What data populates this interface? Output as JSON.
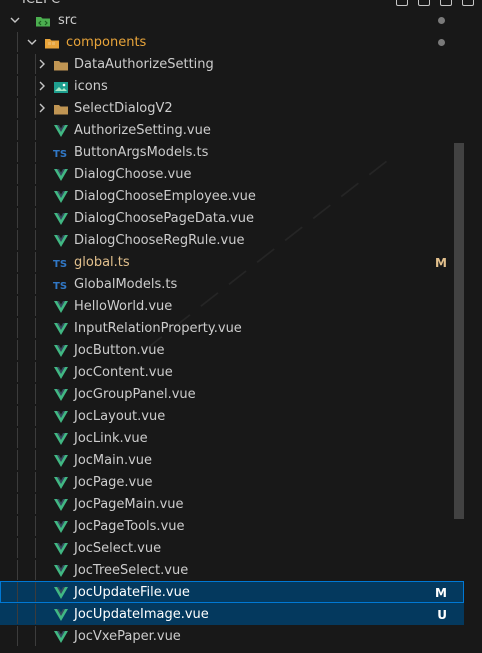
{
  "topbar": {
    "title": "ICEPC"
  },
  "tree": {
    "src": {
      "label": "src"
    },
    "components": {
      "label": "components"
    },
    "folders": [
      {
        "label": "DataAuthorizeSetting",
        "icon": "folder-icon"
      },
      {
        "label": "icons",
        "icon": "image-folder-icon"
      },
      {
        "label": "SelectDialogV2",
        "icon": "folder-icon"
      }
    ],
    "files": [
      {
        "label": "AuthorizeSetting.vue",
        "type": "vue",
        "badge": ""
      },
      {
        "label": "ButtonArgsModels.ts",
        "type": "ts",
        "badge": ""
      },
      {
        "label": "DialogChoose.vue",
        "type": "vue",
        "badge": ""
      },
      {
        "label": "DialogChooseEmployee.vue",
        "type": "vue",
        "badge": ""
      },
      {
        "label": "DialogChoosePageData.vue",
        "type": "vue",
        "badge": ""
      },
      {
        "label": "DialogChooseRegRule.vue",
        "type": "vue",
        "badge": ""
      },
      {
        "label": "global.ts",
        "type": "ts",
        "badge": "M"
      },
      {
        "label": "GlobalModels.ts",
        "type": "ts",
        "badge": ""
      },
      {
        "label": "HelloWorld.vue",
        "type": "vue",
        "badge": ""
      },
      {
        "label": "InputRelationProperty.vue",
        "type": "vue",
        "badge": ""
      },
      {
        "label": "JocButton.vue",
        "type": "vue",
        "badge": ""
      },
      {
        "label": "JocContent.vue",
        "type": "vue",
        "badge": ""
      },
      {
        "label": "JocGroupPanel.vue",
        "type": "vue",
        "badge": ""
      },
      {
        "label": "JocLayout.vue",
        "type": "vue",
        "badge": ""
      },
      {
        "label": "JocLink.vue",
        "type": "vue",
        "badge": ""
      },
      {
        "label": "JocMain.vue",
        "type": "vue",
        "badge": ""
      },
      {
        "label": "JocPage.vue",
        "type": "vue",
        "badge": ""
      },
      {
        "label": "JocPageMain.vue",
        "type": "vue",
        "badge": ""
      },
      {
        "label": "JocPageTools.vue",
        "type": "vue",
        "badge": ""
      },
      {
        "label": "JocSelect.vue",
        "type": "vue",
        "badge": ""
      },
      {
        "label": "JocTreeSelect.vue",
        "type": "vue",
        "badge": ""
      },
      {
        "label": "JocUpdateFile.vue",
        "type": "vue",
        "badge": "M"
      },
      {
        "label": "JocUpdateImage.vue",
        "type": "vue",
        "badge": "U"
      },
      {
        "label": "JocVxePaper.vue",
        "type": "vue",
        "badge": ""
      }
    ]
  },
  "colors": {
    "vue": "#41b883",
    "ts": "#3178c6",
    "modified": "#e2c08d",
    "untracked": "#73c991",
    "folder": "#c09553",
    "components_folder": "#e8a43a"
  }
}
